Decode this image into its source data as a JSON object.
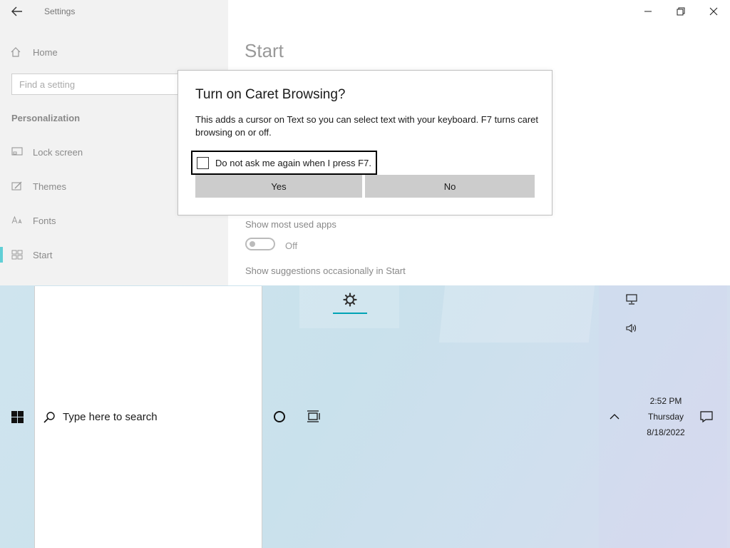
{
  "settings_window": {
    "app_title": "Settings",
    "sidebar": {
      "home_label": "Home",
      "search_placeholder": "Find a setting",
      "section_heading": "Personalization",
      "items": [
        {
          "label": "Lock screen",
          "icon": "lock-screen-icon"
        },
        {
          "label": "Themes",
          "icon": "themes-icon"
        },
        {
          "label": "Fonts",
          "icon": "fonts-icon"
        },
        {
          "label": "Start",
          "icon": "start-icon",
          "active": true
        }
      ]
    },
    "page_title": "Start",
    "settings": [
      {
        "label": "Show most used apps",
        "toggle_state": "Off"
      },
      {
        "label": "Show suggestions occasionally in Start"
      }
    ]
  },
  "dialog": {
    "title": "Turn on Caret Browsing?",
    "body": "This adds a cursor on Text so you can select text with your keyboard. F7 turns caret browsing on or off.",
    "checkbox_label": "Do not ask me again when I press F7.",
    "checkbox_checked": false,
    "yes_label": "Yes",
    "no_label": "No"
  },
  "taskbar": {
    "search_placeholder": "Type here to search",
    "clock": {
      "time": "2:52 PM",
      "day": "Thursday",
      "date": "8/18/2022"
    }
  },
  "colors": {
    "accent": "#00b7c3",
    "dialog_button": "#cccccc",
    "sidebar_bg": "#f2f2f2"
  }
}
